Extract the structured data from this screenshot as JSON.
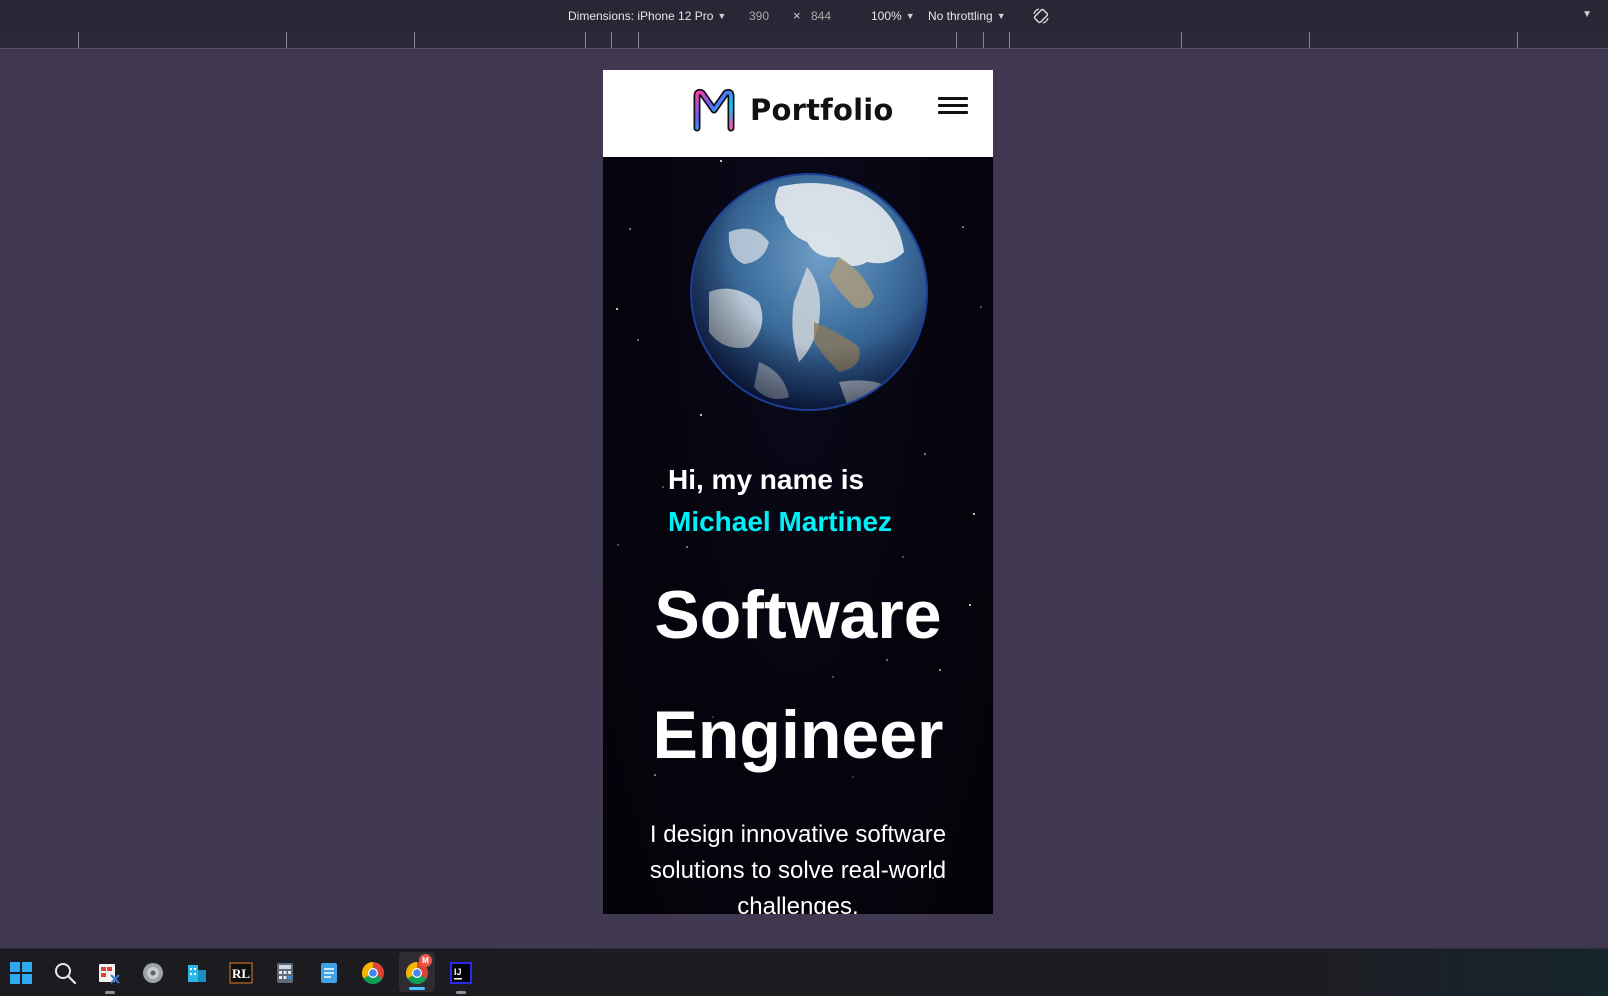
{
  "devtools": {
    "dimensions_label": "Dimensions: iPhone 12 Pro",
    "width": "390",
    "times": "×",
    "height": "844",
    "zoom": "100%",
    "throttling": "No throttling"
  },
  "site": {
    "brand": "Portfolio",
    "greeting": "Hi, my name is",
    "name": "Michael Martinez",
    "role_line1": "Software",
    "role_line2": "Engineer",
    "description": "I design innovative software solutions to solve real-world challenges."
  },
  "colors": {
    "accent": "#00f0f7",
    "page_bg": "#3f3850",
    "hero_bg": "#05040c"
  },
  "taskbar": {
    "apps": [
      "start-icon",
      "search-icon",
      "snipping-tool-icon",
      "disc-icon",
      "file-explorer-icon",
      "rl-app-icon",
      "calculator-icon",
      "notepad-icon",
      "chrome-icon",
      "chrome-profile-icon",
      "intellij-icon"
    ],
    "chrome_badge": "M"
  }
}
